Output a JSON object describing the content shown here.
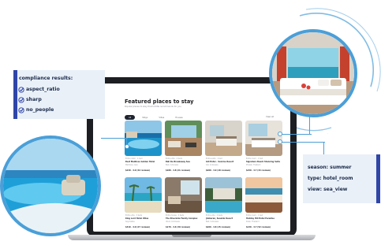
{
  "listing_page": {
    "title": "Featured places to stay",
    "subtitle": "Popular places to stay that Untitle recommends for you",
    "tabs": [
      "All",
      "Stays",
      "Villas",
      "Houses"
    ],
    "view_all": "View all",
    "cards": [
      {
        "meta": "Entire cabin · 1 bed",
        "name": "Best Maldives Golden Hotel",
        "loc": "Maldives, Asia",
        "price": "$240 · 4.9 (32 reviews)",
        "scene": "pool"
      },
      {
        "meta": "Entire villa · 2 beds",
        "name": "Bali De Breakaway Sea",
        "loc": "Bali, Indonesia",
        "price": "$180 · 4.8 (21 reviews)",
        "scene": "terrace"
      },
      {
        "meta": "Entire suite · 1 bed",
        "name": "Gili Hotel – Sunrise Resort",
        "loc": "Gili, Indonesia",
        "price": "$200 · 4.9 (18 reviews)",
        "scene": "bedroom"
      },
      {
        "meta": "Entire room · 1 bed",
        "name": "Signature Beach Stunning Suite",
        "loc": "Phuket, Thailand",
        "price": "$150 · 4.7 (44 reviews)",
        "scene": "suite"
      },
      {
        "meta": "Entire villa · 3 beds",
        "name": "King Lord Hotel Villas",
        "loc": "Seychelles",
        "price": "$310 · 4.9 (27 reviews)",
        "scene": "beach"
      },
      {
        "meta": "Entire house · 2 beds",
        "name": "The Riverside Family Complex",
        "loc": "Ubud, Indonesia",
        "price": "$170 · 4.6 (39 reviews)",
        "scene": "living"
      },
      {
        "meta": "Entire villa · 2 beds",
        "name": "Jimbaran, Seaside Resort",
        "loc": "Bali, Indonesia",
        "price": "$260 · 4.8 (15 reviews)",
        "scene": "villa"
      },
      {
        "meta": "Entire room · 1 bed",
        "name": "Holiday Hill Hotel Paradise",
        "loc": "Krabi, Thailand",
        "price": "$130 · 4.7 (52 reviews)",
        "scene": "bay"
      }
    ]
  },
  "compliance": {
    "title": "compliance results:",
    "items": [
      "aspect_ratio",
      "sharp",
      "no_people"
    ]
  },
  "tags": {
    "lines": [
      "season: summer",
      "type: hotel_room",
      "view: sea_view"
    ]
  },
  "colors": {
    "accent": "#2f45a8",
    "connector": "#4a9fd8",
    "panel_bg": "#e9f0f8",
    "laptop": "#1d1e22"
  }
}
